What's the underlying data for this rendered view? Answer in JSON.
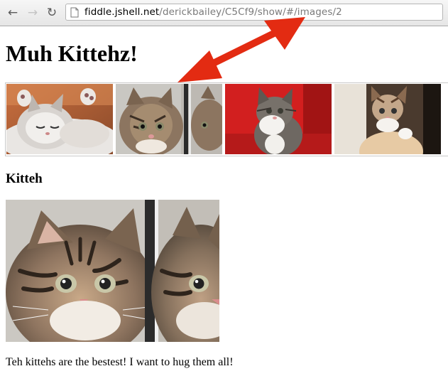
{
  "browser": {
    "back_icon": "arrow-left-icon",
    "forward_icon": "arrow-right-icon",
    "reload_icon": "reload-icon",
    "url_host": "fiddle.jshell.net",
    "url_path": "/derickbailey/C5Cf9/show/#/images/2"
  },
  "page": {
    "title": "Muh Kittehz!",
    "thumbnails": [
      {
        "alt": "sleeping grey and white kitten"
      },
      {
        "alt": "tabby kitten with mirror reflection"
      },
      {
        "alt": "kitten on red background"
      },
      {
        "alt": "kitten peeking over edge"
      }
    ],
    "selected_heading": "Kitteh",
    "selected_caption": "Teh kittehs are the bestest! I want to hug them all!"
  },
  "colors": {
    "annotation_arrow": "#e32b12"
  }
}
